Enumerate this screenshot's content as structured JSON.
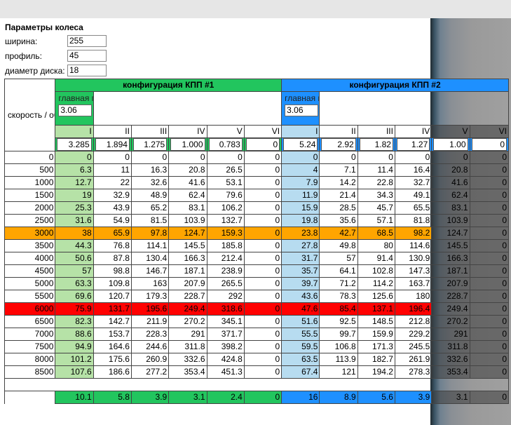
{
  "wheel_params": {
    "title": "Параметры колеса",
    "width_label": "ширина:",
    "width_value": "255",
    "profile_label": "профиль:",
    "profile_value": "45",
    "disk_label": "диаметр диска:",
    "disk_value": "18"
  },
  "table": {
    "speed_label": "скорость / обороты",
    "config1_title": "конфигурация КПП #1",
    "config2_title": "конфигурация КПП #2",
    "main_pair_label": "главная пара",
    "config1_main_pair": "3.06",
    "config2_main_pair": "3.06",
    "gears1": [
      "I",
      "II",
      "III",
      "IV",
      "V",
      "VI"
    ],
    "gears2": [
      "I",
      "II",
      "III",
      "IV",
      "V",
      "VI"
    ],
    "ratios1": [
      "3.285",
      "1.894",
      "1.275",
      "1.000",
      "0.783",
      "0"
    ],
    "ratios2": [
      "5.24",
      "2.92",
      "1.82",
      "1.27",
      "1.00",
      "0"
    ],
    "rows": [
      {
        "rpm": "0",
        "c1": [
          "0",
          "0",
          "0",
          "0",
          "0",
          "0"
        ],
        "c2": [
          "0",
          "0",
          "0",
          "0",
          "0",
          "0"
        ]
      },
      {
        "rpm": "500",
        "c1": [
          "6.3",
          "11",
          "16.3",
          "20.8",
          "26.5",
          "0"
        ],
        "c2": [
          "4",
          "7.1",
          "11.4",
          "16.4",
          "20.8",
          "0"
        ]
      },
      {
        "rpm": "1000",
        "c1": [
          "12.7",
          "22",
          "32.6",
          "41.6",
          "53.1",
          "0"
        ],
        "c2": [
          "7.9",
          "14.2",
          "22.8",
          "32.7",
          "41.6",
          "0"
        ]
      },
      {
        "rpm": "1500",
        "c1": [
          "19",
          "32.9",
          "48.9",
          "62.4",
          "79.6",
          "0"
        ],
        "c2": [
          "11.9",
          "21.4",
          "34.3",
          "49.1",
          "62.4",
          "0"
        ]
      },
      {
        "rpm": "2000",
        "c1": [
          "25.3",
          "43.9",
          "65.2",
          "83.1",
          "106.2",
          "0"
        ],
        "c2": [
          "15.9",
          "28.5",
          "45.7",
          "65.5",
          "83.1",
          "0"
        ]
      },
      {
        "rpm": "2500",
        "c1": [
          "31.6",
          "54.9",
          "81.5",
          "103.9",
          "132.7",
          "0"
        ],
        "c2": [
          "19.8",
          "35.6",
          "57.1",
          "81.8",
          "103.9",
          "0"
        ]
      },
      {
        "rpm": "3000",
        "c1": [
          "38",
          "65.9",
          "97.8",
          "124.7",
          "159.3",
          "0"
        ],
        "c2": [
          "23.8",
          "42.7",
          "68.5",
          "98.2",
          "124.7",
          "0"
        ]
      },
      {
        "rpm": "3500",
        "c1": [
          "44.3",
          "76.8",
          "114.1",
          "145.5",
          "185.8",
          "0"
        ],
        "c2": [
          "27.8",
          "49.8",
          "80",
          "114.6",
          "145.5",
          "0"
        ]
      },
      {
        "rpm": "4000",
        "c1": [
          "50.6",
          "87.8",
          "130.4",
          "166.3",
          "212.4",
          "0"
        ],
        "c2": [
          "31.7",
          "57",
          "91.4",
          "130.9",
          "166.3",
          "0"
        ]
      },
      {
        "rpm": "4500",
        "c1": [
          "57",
          "98.8",
          "146.7",
          "187.1",
          "238.9",
          "0"
        ],
        "c2": [
          "35.7",
          "64.1",
          "102.8",
          "147.3",
          "187.1",
          "0"
        ]
      },
      {
        "rpm": "5000",
        "c1": [
          "63.3",
          "109.8",
          "163",
          "207.9",
          "265.5",
          "0"
        ],
        "c2": [
          "39.7",
          "71.2",
          "114.2",
          "163.7",
          "207.9",
          "0"
        ]
      },
      {
        "rpm": "5500",
        "c1": [
          "69.6",
          "120.7",
          "179.3",
          "228.7",
          "292",
          "0"
        ],
        "c2": [
          "43.6",
          "78.3",
          "125.6",
          "180",
          "228.7",
          "0"
        ]
      },
      {
        "rpm": "6000",
        "c1": [
          "75.9",
          "131.7",
          "195.6",
          "249.4",
          "318.6",
          "0"
        ],
        "c2": [
          "47.6",
          "85.4",
          "137.1",
          "196.4",
          "249.4",
          "0"
        ]
      },
      {
        "rpm": "6500",
        "c1": [
          "82.3",
          "142.7",
          "211.9",
          "270.2",
          "345.1",
          "0"
        ],
        "c2": [
          "51.6",
          "92.5",
          "148.5",
          "212.8",
          "270.2",
          "0"
        ]
      },
      {
        "rpm": "7000",
        "c1": [
          "88.6",
          "153.7",
          "228.3",
          "291",
          "371.7",
          "0"
        ],
        "c2": [
          "55.5",
          "99.7",
          "159.9",
          "229.2",
          "291",
          "0"
        ]
      },
      {
        "rpm": "7500",
        "c1": [
          "94.9",
          "164.6",
          "244.6",
          "311.8",
          "398.2",
          "0"
        ],
        "c2": [
          "59.5",
          "106.8",
          "171.3",
          "245.5",
          "311.8",
          "0"
        ]
      },
      {
        "rpm": "8000",
        "c1": [
          "101.2",
          "175.6",
          "260.9",
          "332.6",
          "424.8",
          "0"
        ],
        "c2": [
          "63.5",
          "113.9",
          "182.7",
          "261.9",
          "332.6",
          "0"
        ]
      },
      {
        "rpm": "8500",
        "c1": [
          "107.6",
          "186.6",
          "277.2",
          "353.4",
          "451.3",
          "0"
        ],
        "c2": [
          "67.4",
          "121",
          "194.2",
          "278.3",
          "353.4",
          "0"
        ]
      }
    ],
    "sums1": [
      "10.1",
      "5.8",
      "3.9",
      "3.1",
      "2.4",
      "0"
    ],
    "sums2": [
      "16",
      "8.9",
      "5.6",
      "3.9",
      "3.1",
      "0"
    ]
  },
  "colors": {
    "green": "#22c55e",
    "blue": "#1e90ff",
    "orange": "#ffa500",
    "red": "#ff0000"
  }
}
